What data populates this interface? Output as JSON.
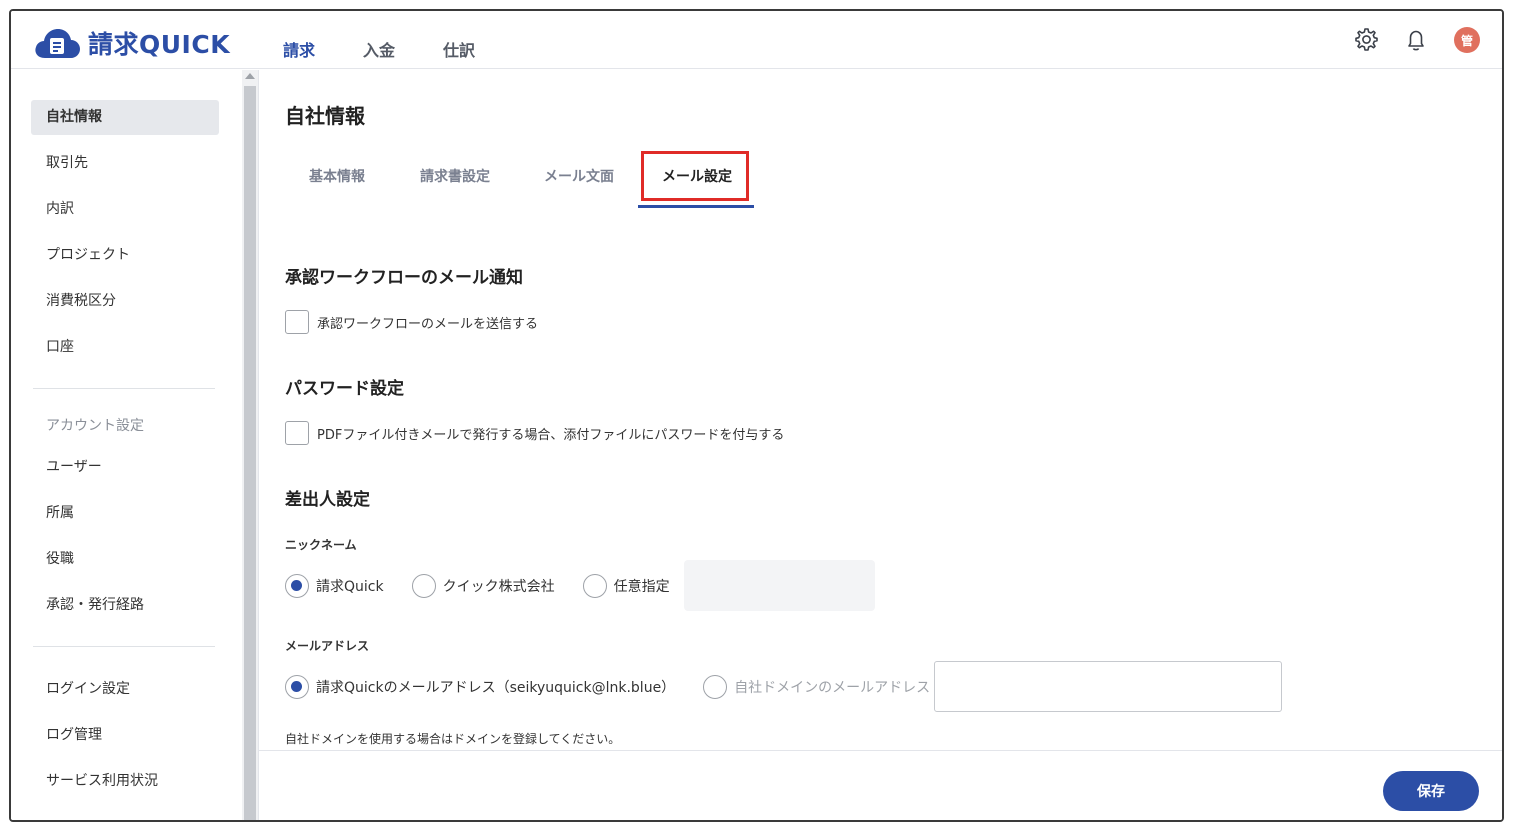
{
  "app": {
    "logo_text": "請求QUICK",
    "brand_color": "#2c4ea6"
  },
  "topnav": [
    {
      "label": "請求",
      "active": true
    },
    {
      "label": "入金",
      "active": false
    },
    {
      "label": "仕訳",
      "active": false
    }
  ],
  "header_icons": [
    "gear-icon",
    "bell-icon"
  ],
  "avatar": {
    "text": "管",
    "color": "#e0705e"
  },
  "sidebar": {
    "items": [
      {
        "label": "自社情報",
        "active": true
      },
      {
        "label": "取引先"
      },
      {
        "label": "内訳"
      },
      {
        "label": "プロジェクト"
      },
      {
        "label": "消費税区分"
      },
      {
        "label": "口座"
      }
    ],
    "account_section": "アカウント設定",
    "account_items": [
      {
        "label": "ユーザー"
      },
      {
        "label": "所属"
      },
      {
        "label": "役職"
      },
      {
        "label": "承認・発行経路"
      }
    ],
    "other_items": [
      {
        "label": "ログイン設定"
      },
      {
        "label": "ログ管理"
      },
      {
        "label": "サービス利用状況"
      }
    ]
  },
  "main": {
    "title": "自社情報",
    "tabs": [
      {
        "label": "基本情報"
      },
      {
        "label": "請求書設定"
      },
      {
        "label": "メール文面"
      },
      {
        "label": "メール設定",
        "active": true
      }
    ],
    "approval": {
      "title": "承認ワークフローのメール通知",
      "checkbox_label": "承認ワークフローのメールを送信する",
      "checked": false
    },
    "password": {
      "title": "パスワード設定",
      "checkbox_label": "PDFファイル付きメールで発行する場合、添付ファイルにパスワードを付与する",
      "checked": false
    },
    "sender": {
      "title": "差出人設定",
      "nickname_label": "ニックネーム",
      "nickname_options": [
        {
          "label": "請求Quick",
          "checked": true
        },
        {
          "label": "クイック株式会社",
          "checked": false
        },
        {
          "label": "任意指定",
          "checked": false
        }
      ],
      "nickname_input_value": "",
      "email_label": "メールアドレス",
      "email_options": [
        {
          "label": "請求Quickのメールアドレス（seikyuquick@lnk.blue）",
          "checked": true
        },
        {
          "label": "自社ドメインのメールアドレス",
          "checked": false
        }
      ],
      "email_input_value": "",
      "note": "自社ドメインを使用する場合はドメインを登録してください。"
    },
    "save_label": "保存"
  }
}
